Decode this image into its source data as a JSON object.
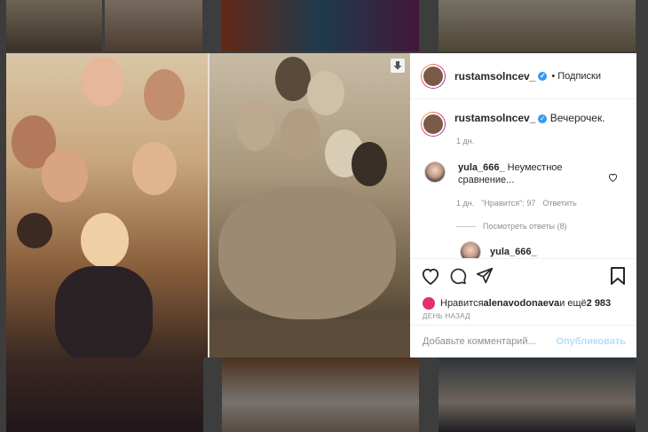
{
  "post": {
    "author": "rustamsolncev_",
    "separator": "•",
    "follow_label": "Подписки",
    "caption": "Вечерочек.",
    "caption_time": "1 дн.",
    "verified_mark": "✓"
  },
  "comment": {
    "user": "yula_666_",
    "text": "Неуместное сравнение...",
    "time": "1 дн.",
    "likes": "\"Нравится\": 97",
    "reply_label": "Ответить",
    "view_replies": "Посмотреть ответы (8)",
    "next_cut": "yula_666_"
  },
  "likes_line": {
    "prefix": "Нравится ",
    "liker": "alenavodonaeva",
    "suffix": " и ещё ",
    "count": "2 983"
  },
  "posted_ago": "ДЕНЬ НАЗАД",
  "add_comment": {
    "placeholder": "Добавьте комментарий...",
    "publish_label": "Опубликовать"
  },
  "colors": {
    "accent": "#3897f0",
    "publish_disabled": "#b2dffc",
    "meta": "#8e8e8e"
  }
}
